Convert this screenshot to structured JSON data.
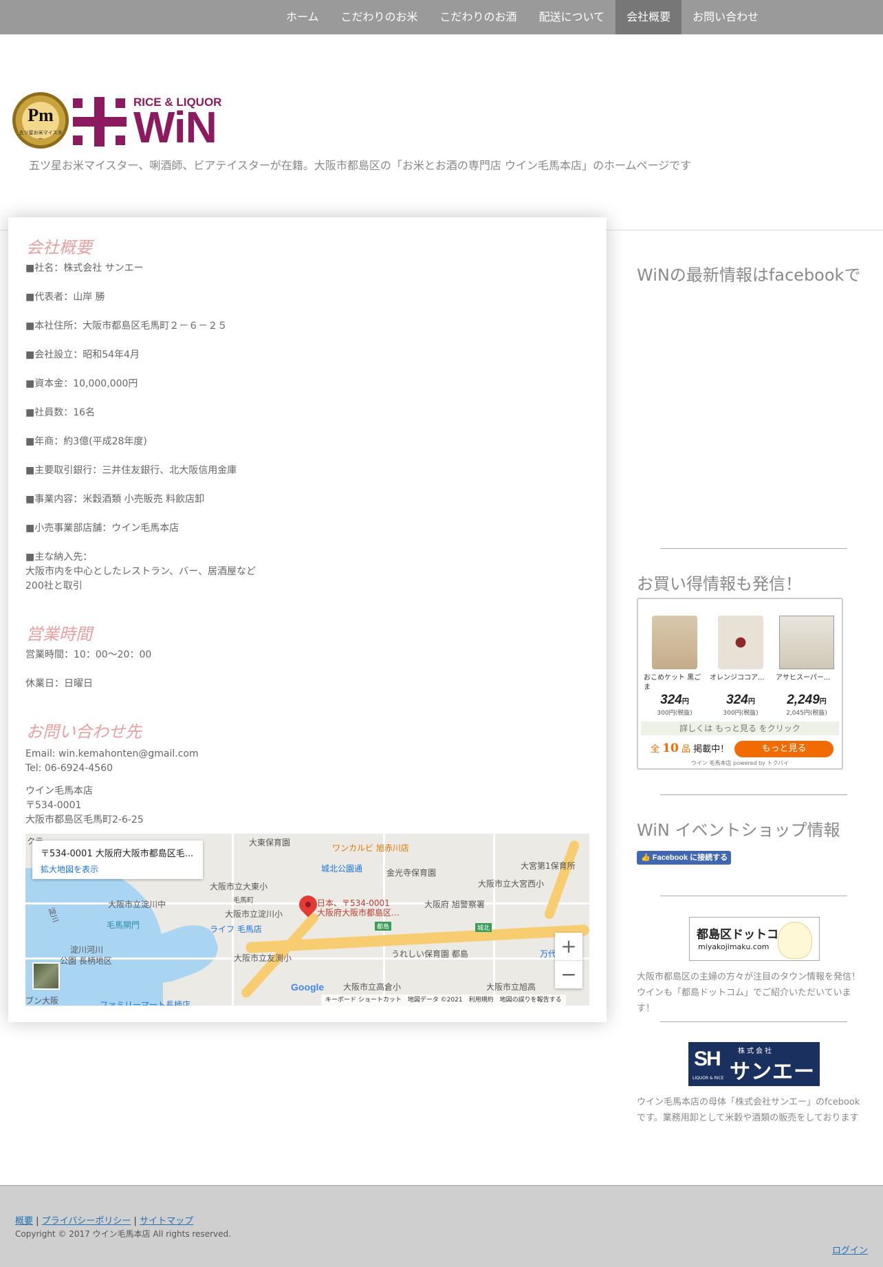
{
  "nav": {
    "items": [
      "ホーム",
      "こだわりのお米",
      "こだわりのお酒",
      "配送について",
      "会社概要",
      "お問い合わせ"
    ],
    "active": "会社概要"
  },
  "header": {
    "badge_text": "Pm",
    "badge_caption": "五ツ星お米マイスター",
    "brand_top": "RICE & LIQUOR",
    "brand_main": "WiN",
    "tagline": "五ツ星お米マイスター、唎酒師、ビアテイスターが在籍。大阪市都島区の「お米とお酒の専門店 ウイン毛馬本店」のホームページです"
  },
  "company": {
    "heading": "会社概要",
    "lines": [
      "■社名：株式会社 サンエー",
      "■代表者：山岸 勝",
      "■本社住所：大阪市都島区毛馬町２－６－２５",
      "■会社設立：昭和54年4月",
      "■資本金：10,000,000円",
      "■社員数：16名",
      "■年商：約3億(平成28年度)",
      "■主要取引銀行：三井住友銀行、北大阪信用金庫",
      "■事業内容：米穀酒類 小売販売 料飲店卸",
      "■小売事業部店舗：ウイン毛馬本店",
      "■主な納入先：",
      "大阪市内を中心としたレストラン、バー、居酒屋など",
      "200社と取引"
    ]
  },
  "hours": {
    "heading": "営業時間",
    "open": "営業時間：10：00～20：00",
    "closed": "休業日：日曜日"
  },
  "contact": {
    "heading": "お問い合わせ先",
    "email": "Email: win.kemahonten@gmail.com",
    "tel": "Tel: 06-6924-4560",
    "shop": "ウイン毛馬本店",
    "zip": "〒534-0001",
    "address": "大阪市都島区毛馬町2-6-25"
  },
  "map": {
    "place_title": "〒534-0001 大阪府大阪市都島区毛...",
    "enlarge_link": "拡大地図を表示",
    "pin_label1": "日本、〒534-0001",
    "pin_label2": "大阪府大阪市都島区…",
    "labels": {
      "l1": "大東保育園",
      "l2": "ワンカルビ 旭赤川店",
      "l3": "城北公園通",
      "l4": "金光寺保育園",
      "l5": "大宮第1保育所",
      "l6": "大阪市立大東小",
      "l7": "大阪市立大宮西小",
      "l8": "毛馬町",
      "l9": "大阪市立淀川中",
      "l10": "大阪市立淀川小",
      "l11": "大阪府 旭警察署",
      "l12": "毛馬閘門",
      "l13": "ライフ 毛馬店",
      "l14": "都島",
      "l15": "城北",
      "l16": "淀川河川",
      "l17": "公園 長柄地区",
      "l18": "大阪市立友渕小",
      "l19": "うれしい保育園 都島",
      "l20": "万代",
      "l21": "大阪市立高倉小",
      "l22": "大阪市立旭高",
      "l23": "クラ",
      "l24": "淀川",
      "l25": "ブン大阪",
      "l26": "ファミリーマート長柄店"
    },
    "zoom_in": "+",
    "zoom_out": "−",
    "google": "Google",
    "attribution": "キーボード ショートカット　地図データ ©2021　利用規約　地図の誤りを報告する"
  },
  "sidebar": {
    "facebook_heading": "WiNの最新情報はfacebookで",
    "deals_heading": "お買い得情報も発信！",
    "products": [
      {
        "name": "おこめケット 黒ごま",
        "price": "324",
        "unit": "円",
        "sub": "300円(税抜)"
      },
      {
        "name": "オレンジココア...",
        "price": "324",
        "unit": "円",
        "sub": "300円(税抜)"
      },
      {
        "name": "アサヒスーパー...",
        "price": "2,249",
        "unit": "円",
        "sub": "2,045円(税抜)"
      }
    ],
    "more_hint": "詳しくは もっと見る をクリック",
    "count_prefix": "全",
    "count_number": "10",
    "count_unit": "品",
    "count_suffix": "掲載中！",
    "more_button": "もっと見る",
    "powered": "ウイン 毛馬本店 powered by トクバイ",
    "event_heading": "WiN イベントショップ情報",
    "fb_connect": "Facebook に接続する",
    "miyako_title": "都島区ドットコム",
    "miyako_url": "miyakojimaku.com",
    "miyako_note": "大阪市都島区の主婦の方々が注目のタウン情報を発信！ウインも「都島ドットコム」でご紹介いただいています！",
    "sanei_kabushiki": "株式会社",
    "sanei_name": "サンエー",
    "sanei_su": "SH",
    "sanei_sub": "LIQUOR & RICE",
    "sanei_note": "ウイン毛馬本店の母体「株式会社サンエー」のfcebookです。業務用卸として米穀や酒類の販売をしております"
  },
  "footer": {
    "link1": "概要",
    "link2": "プライバシーポリシー",
    "link3": "サイトマップ",
    "sep": " | ",
    "copyright": "Copyright © 2017 ウイン毛馬本店 All rights reserved.",
    "login": "ログイン"
  },
  "colors": {
    "brand": "#8b1a5e",
    "heading_pink": "#e8a0a0",
    "nav_bg": "#9a9a9a",
    "nav_active": "#777777",
    "accent_orange": "#f26b00"
  }
}
